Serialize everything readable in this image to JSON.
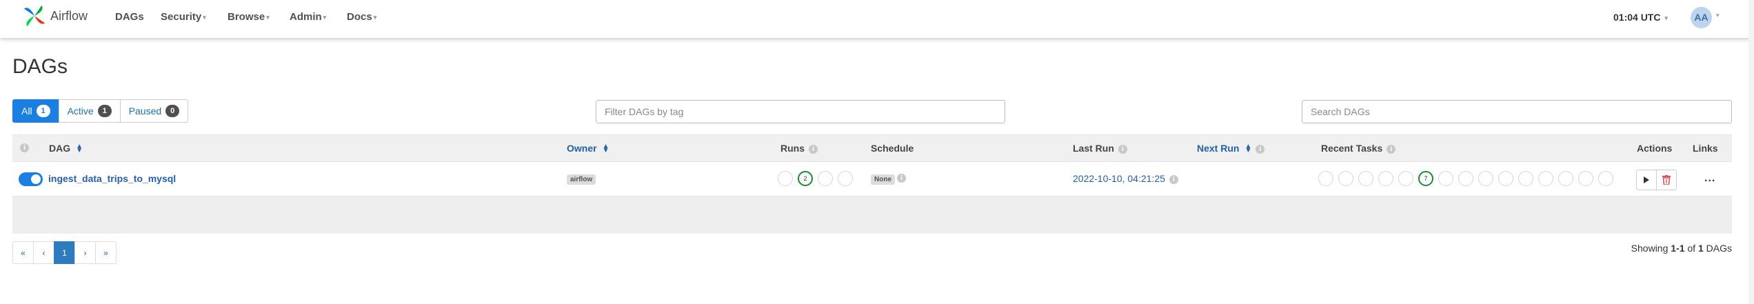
{
  "nav": {
    "brand": "Airflow",
    "items": [
      "DAGs",
      "Security",
      "Browse",
      "Admin",
      "Docs"
    ],
    "time": "01:04 UTC",
    "user_initials": "AA"
  },
  "page": {
    "title": "DAGs"
  },
  "filters": {
    "all_label": "All",
    "all_count": "1",
    "active_label": "Active",
    "active_count": "1",
    "paused_label": "Paused",
    "paused_count": "0",
    "tag_placeholder": "Filter DAGs by tag",
    "search_placeholder": "Search DAGs"
  },
  "table": {
    "headers": {
      "dag": "DAG",
      "owner": "Owner",
      "runs": "Runs",
      "schedule": "Schedule",
      "last_run": "Last Run",
      "next_run": "Next Run",
      "recent_tasks": "Recent Tasks",
      "actions": "Actions",
      "links": "Links"
    },
    "row": {
      "paused": false,
      "dag_id": "ingest_data_trips_to_mysql",
      "owner": "airflow",
      "runs_count": "2",
      "schedule": "None",
      "last_run": "2022-10-10, 04:21:25",
      "recent_tasks_count": "7",
      "links_label": "..."
    }
  },
  "pagination": {
    "first": "«",
    "prev": "‹",
    "page": "1",
    "next": "›",
    "last": "»"
  },
  "footer": {
    "showing_prefix": "Showing ",
    "range": "1-1",
    "of": " of ",
    "total": "1",
    "suffix": " DAGs"
  },
  "colors": {
    "accent": "#1a7fe0",
    "link": "#2360a8",
    "success": "#188d30",
    "danger": "#d9534f"
  }
}
